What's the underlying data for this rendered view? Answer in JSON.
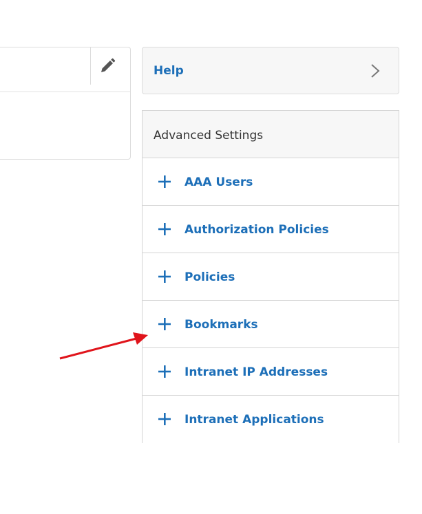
{
  "help": {
    "label": "Help"
  },
  "advanced_settings": {
    "title": "Advanced Settings",
    "items": [
      {
        "label": "AAA Users"
      },
      {
        "label": "Authorization Policies"
      },
      {
        "label": "Policies"
      },
      {
        "label": "Bookmarks"
      },
      {
        "label": "Intranet IP Addresses"
      },
      {
        "label": "Intranet Applications"
      }
    ]
  },
  "icons": {
    "edit": "pencil-icon",
    "help_chevron": "chevron-right-icon",
    "add": "plus-icon",
    "annotation": "red-arrow-icon"
  },
  "colors": {
    "link": "#1d6fb8",
    "header_bg": "#f7f7f7",
    "border": "#d4d4d4",
    "title_text": "#333333",
    "annotation": "#e0141b"
  }
}
